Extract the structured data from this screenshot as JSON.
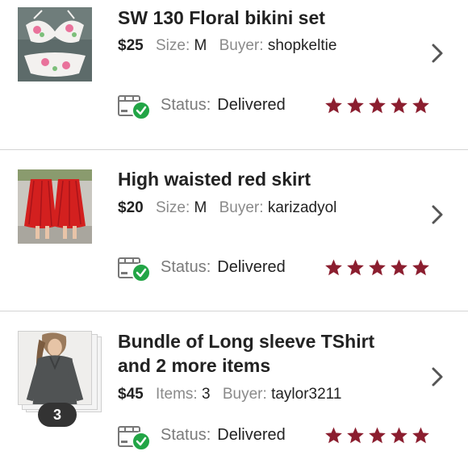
{
  "colors": {
    "accent_star": "#8b1e2f",
    "delivered_green": "#22a546",
    "label_gray": "#8a8a8a"
  },
  "orders": [
    {
      "title_lines": [
        "SW 130 Floral bikini set"
      ],
      "price": "$25",
      "attr_label": "Size:",
      "attr_value": "M",
      "buyer_label": "Buyer:",
      "buyer": "shopkeltie",
      "status_label": "Status:",
      "status": "Delivered",
      "rating": 5,
      "thumbnail_icon": "bikini-photo-icon"
    },
    {
      "title_lines": [
        "High waisted red skirt"
      ],
      "price": "$20",
      "attr_label": "Size:",
      "attr_value": "M",
      "buyer_label": "Buyer:",
      "buyer": "karizadyol",
      "status_label": "Status:",
      "status": "Delivered",
      "rating": 5,
      "thumbnail_icon": "skirt-photo-icon"
    },
    {
      "title_lines": [
        "Bundle of Long sleeve TShirt",
        "and 2 more items"
      ],
      "price": "$45",
      "attr_label": "Items:",
      "attr_value": "3",
      "buyer_label": "Buyer:",
      "buyer": "taylor3211",
      "status_label": "Status:",
      "status": "Delivered",
      "rating": 5,
      "bundle_count": "3",
      "thumbnail_icon": "tshirt-photo-icon"
    }
  ]
}
